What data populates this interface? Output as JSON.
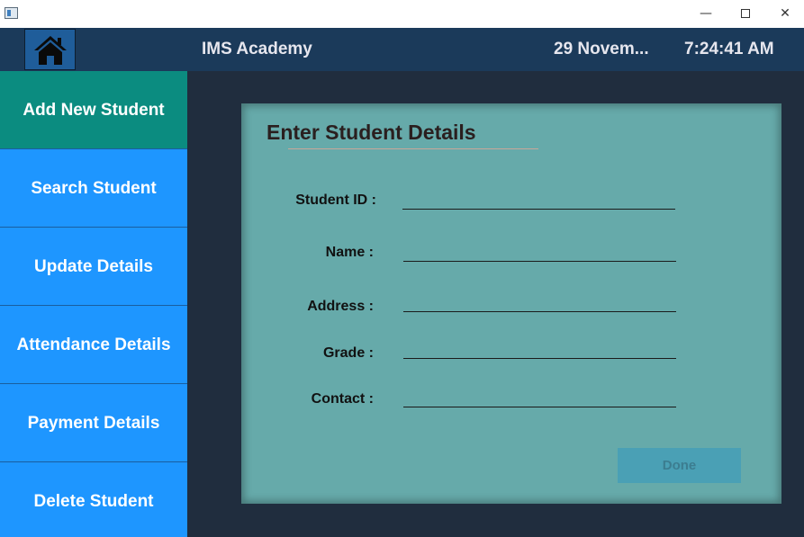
{
  "window": {
    "minimize_glyph": "—",
    "close_glyph": "✕"
  },
  "header": {
    "home_icon": "home-icon",
    "app_title": "IMS Academy",
    "date": "29 Novem...",
    "time": "7:24:41 AM"
  },
  "sidebar": {
    "items": [
      {
        "label": "Add New Student",
        "active": true
      },
      {
        "label": "Search Student",
        "active": false
      },
      {
        "label": "Update Details",
        "active": false
      },
      {
        "label": "Attendance Details",
        "active": false
      },
      {
        "label": "Payment Details",
        "active": false
      },
      {
        "label": "Delete Student",
        "active": false
      }
    ]
  },
  "form": {
    "title": "Enter Student Details",
    "fields": [
      {
        "label": "Student ID :",
        "value": ""
      },
      {
        "label": "Name :",
        "value": ""
      },
      {
        "label": "Address :",
        "value": ""
      },
      {
        "label": "Grade :",
        "value": ""
      },
      {
        "label": "Contact :",
        "value": ""
      }
    ],
    "done_label": "Done"
  },
  "colors": {
    "header_bg": "#1b3a5a",
    "content_bg": "#202d3e",
    "sidebar_bg": "#1e96ff",
    "sidebar_active_bg": "#0b8c80",
    "panel_bg": "#66aaaa",
    "done_bg": "#4aa0b5"
  }
}
